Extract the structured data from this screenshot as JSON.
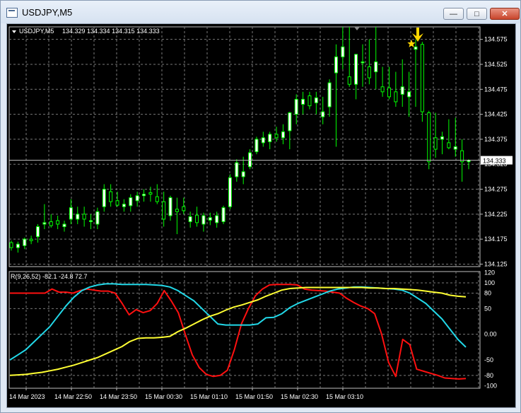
{
  "window": {
    "title": "USDJPY,M5",
    "minimize_label": "—",
    "maximize_label": "□",
    "close_label": "✕"
  },
  "chart_header": {
    "symbol": "USDJPY,M5",
    "ohlc": "134.329 134.334 134.315 134.333"
  },
  "indicator_label": "R(9,26,52) -82.1 -24.8 72.7",
  "current_price": "134.333",
  "colors": {
    "background": "#000000",
    "grid": "#7a7a7a",
    "candles": "#00ff00",
    "bull_body": "#ffffff",
    "bear_body": "#000000",
    "arrow": "#ffd700",
    "rsi_fast": "#ff1010",
    "rsi_mid": "#22d8e8",
    "rsi_slow": "#ffff33"
  },
  "icons": {
    "window": "chart-window-icon",
    "signal_arrow": "down-arrow-icon",
    "signal_star": "star-icon"
  },
  "chart_data": [
    {
      "type": "candlestick",
      "symbol": "USDJPY",
      "timeframe": "M5",
      "y_ticks": [
        "134.575",
        "134.525",
        "134.475",
        "134.425",
        "134.375",
        "134.325",
        "134.275",
        "134.225",
        "134.175",
        "134.125"
      ],
      "ylim": [
        134.12,
        134.6
      ],
      "x_ticks": [
        "14 Mar 2023",
        "14 Mar 22:50",
        "14 Mar 23:50",
        "15 Mar 00:30",
        "15 Mar 01:10",
        "15 Mar 01:50",
        "15 Mar 02:30",
        "15 Mar 03:10"
      ],
      "last_price": 134.333,
      "candles": [
        [
          134.168,
          134.172,
          134.152,
          134.158
        ],
        [
          134.158,
          134.17,
          134.148,
          134.165
        ],
        [
          134.162,
          134.178,
          134.155,
          134.175
        ],
        [
          134.175,
          134.182,
          134.165,
          134.172
        ],
        [
          134.18,
          134.205,
          134.168,
          134.2
        ],
        [
          134.205,
          134.245,
          134.195,
          134.208
        ],
        [
          134.21,
          134.225,
          134.198,
          134.202
        ],
        [
          134.212,
          134.222,
          134.195,
          134.205
        ],
        [
          134.2,
          134.212,
          134.19,
          134.205
        ],
        [
          134.215,
          134.255,
          134.205,
          134.238
        ],
        [
          134.215,
          134.24,
          134.205,
          134.225
        ],
        [
          134.225,
          134.24,
          134.2,
          134.215
        ],
        [
          134.21,
          134.225,
          134.195,
          134.212
        ],
        [
          134.205,
          134.238,
          134.195,
          134.23
        ],
        [
          134.24,
          134.285,
          134.23,
          134.275
        ],
        [
          134.27,
          134.285,
          134.24,
          134.25
        ],
        [
          134.252,
          134.27,
          134.24,
          134.243
        ],
        [
          134.24,
          134.255,
          134.23,
          134.245
        ],
        [
          134.242,
          134.265,
          134.23,
          134.258
        ],
        [
          134.252,
          134.27,
          134.24,
          134.262
        ],
        [
          134.262,
          134.275,
          134.25,
          134.265
        ],
        [
          134.268,
          134.28,
          134.25,
          134.265
        ],
        [
          134.26,
          134.285,
          134.245,
          134.25
        ],
        [
          134.25,
          134.27,
          134.2,
          134.215
        ],
        [
          134.222,
          134.262,
          134.212,
          134.258
        ],
        [
          134.235,
          134.258,
          134.185,
          134.23
        ],
        [
          134.24,
          134.258,
          134.225,
          134.232
        ],
        [
          134.21,
          134.23,
          134.198,
          134.22
        ],
        [
          134.223,
          134.24,
          134.2,
          134.208
        ],
        [
          134.205,
          134.228,
          134.19,
          134.222
        ],
        [
          134.213,
          134.228,
          134.203,
          134.218
        ],
        [
          134.208,
          134.23,
          134.198,
          134.222
        ],
        [
          134.21,
          134.242,
          134.205,
          134.238
        ],
        [
          134.24,
          134.305,
          134.235,
          134.298
        ],
        [
          134.3,
          134.335,
          134.29,
          134.328
        ],
        [
          134.3,
          134.34,
          134.285,
          134.31
        ],
        [
          134.32,
          134.355,
          134.315,
          134.348
        ],
        [
          134.35,
          134.38,
          134.345,
          134.375
        ],
        [
          134.368,
          134.39,
          134.36,
          134.378
        ],
        [
          134.37,
          134.39,
          134.355,
          134.385
        ],
        [
          134.385,
          134.4,
          134.37,
          134.378
        ],
        [
          134.378,
          134.405,
          134.365,
          134.39
        ],
        [
          134.392,
          134.43,
          134.355,
          134.428
        ],
        [
          134.425,
          134.465,
          134.405,
          134.455
        ],
        [
          134.445,
          134.47,
          134.425,
          134.455
        ],
        [
          134.462,
          134.47,
          134.435,
          134.442
        ],
        [
          134.448,
          134.47,
          134.425,
          134.458
        ],
        [
          134.42,
          134.46,
          134.405,
          134.43
        ],
        [
          134.44,
          134.495,
          134.42,
          134.488
        ],
        [
          134.508,
          134.565,
          134.36,
          134.54
        ],
        [
          134.54,
          134.6,
          134.515,
          134.56
        ],
        [
          134.5,
          134.6,
          134.48,
          134.485
        ],
        [
          134.485,
          134.545,
          134.455,
          134.545
        ],
        [
          134.528,
          134.565,
          134.48,
          134.53
        ],
        [
          134.52,
          134.575,
          134.485,
          134.498
        ],
        [
          134.51,
          134.6,
          134.475,
          134.53
        ],
        [
          134.48,
          134.52,
          134.46,
          134.47
        ],
        [
          134.478,
          134.52,
          134.455,
          134.46
        ],
        [
          134.47,
          134.51,
          134.44,
          134.45
        ],
        [
          134.465,
          134.535,
          134.44,
          134.48
        ],
        [
          134.46,
          134.51,
          134.42,
          134.47
        ],
        [
          134.555,
          134.575,
          134.44,
          134.56
        ],
        [
          134.565,
          134.57,
          134.41,
          134.43
        ],
        [
          134.428,
          134.432,
          134.315,
          134.33
        ],
        [
          134.378,
          134.428,
          134.338,
          134.355
        ],
        [
          134.375,
          134.39,
          134.345,
          134.38
        ],
        [
          134.368,
          134.415,
          134.355,
          134.358
        ],
        [
          134.355,
          134.418,
          134.34,
          134.36
        ],
        [
          134.352,
          134.375,
          134.29,
          134.33
        ],
        [
          134.33,
          134.335,
          134.315,
          134.333
        ]
      ]
    },
    {
      "type": "line",
      "title": "R(9,26,52)",
      "values_shown": [
        -82.1,
        -24.8,
        72.7
      ],
      "y_ticks": [
        "120",
        "100",
        "80",
        "50",
        "0.00",
        "-50",
        "-80",
        "-100"
      ],
      "ylim": [
        -105,
        122
      ],
      "series": [
        {
          "color": "#ff1010",
          "values": [
            80,
            80,
            80,
            80,
            80,
            80,
            88,
            82,
            82,
            80,
            85,
            88,
            86,
            84,
            84,
            80,
            60,
            38,
            48,
            42,
            46,
            60,
            85,
            65,
            42,
            0,
            -40,
            -65,
            -78,
            -82,
            -80,
            -70,
            -30,
            20,
            50,
            75,
            88,
            96,
            97,
            97,
            97,
            96,
            88,
            86,
            85,
            84,
            82,
            80,
            70,
            62,
            55,
            50,
            40,
            0,
            -55,
            -82,
            -10,
            -20,
            -68,
            -72,
            -76,
            -80,
            -85,
            -86,
            -87,
            -86
          ]
        },
        {
          "color": "#22d8e8",
          "values": [
            -50,
            -40,
            -30,
            -15,
            0,
            15,
            35,
            55,
            72,
            85,
            92,
            96,
            98,
            98,
            97,
            97,
            97,
            97,
            96,
            95,
            92,
            85,
            75,
            65,
            50,
            35,
            20,
            18,
            18,
            18,
            18,
            20,
            32,
            33,
            40,
            52,
            60,
            66,
            72,
            78,
            84,
            88,
            90,
            92,
            92,
            91,
            90,
            89,
            88,
            86,
            80,
            70,
            60,
            45,
            30,
            10,
            -10,
            -25
          ]
        },
        {
          "color": "#ffff33",
          "values": [
            -80,
            -79,
            -78,
            -76,
            -74,
            -71,
            -68,
            -64,
            -60,
            -55,
            -50,
            -45,
            -38,
            -31,
            -24,
            -14,
            -8,
            -7,
            -7,
            -6,
            -4,
            5,
            12,
            20,
            28,
            35,
            40,
            47,
            53,
            57,
            62,
            67,
            74,
            80,
            86,
            89,
            90,
            91,
            91,
            91,
            91,
            91,
            91,
            91,
            91,
            90,
            90,
            89,
            89,
            88,
            87,
            86,
            84,
            82,
            80,
            76,
            74,
            72.7
          ]
        }
      ]
    }
  ]
}
